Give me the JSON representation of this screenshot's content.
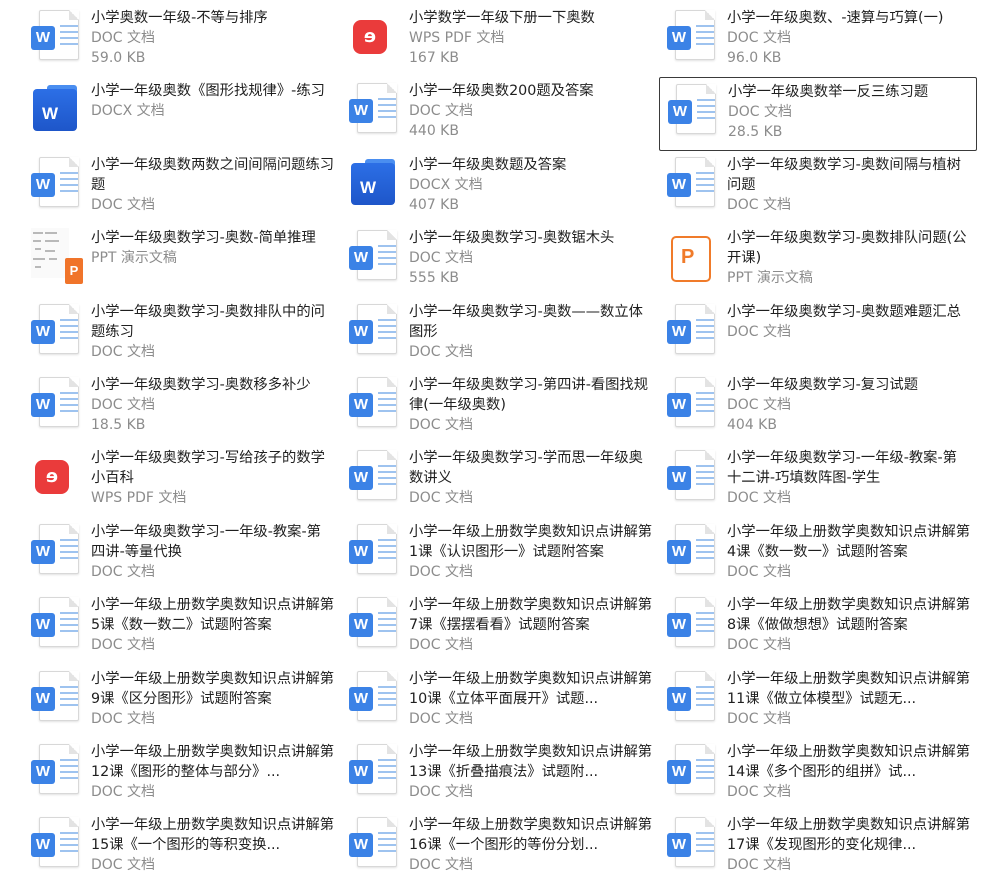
{
  "files": [
    {
      "name": "小学奥数一年级-不等与排序",
      "type": "DOC 文档",
      "size": "59.0 KB",
      "icon": "word-doc-icon"
    },
    {
      "name": "小学数学一年级下册一下奥数",
      "type": "WPS PDF 文档",
      "size": "167 KB",
      "icon": "wps-pdf-icon"
    },
    {
      "name": "小学一年级奥数、-速算与巧算(一)",
      "type": "DOC 文档",
      "size": "96.0 KB",
      "icon": "word-doc-icon"
    },
    {
      "name": "小学一年级奥数《图形找规律》-练习",
      "type": "DOCX 文档",
      "size": "",
      "icon": "word-docx-icon"
    },
    {
      "name": "小学一年级奥数200题及答案",
      "type": "DOC 文档",
      "size": "440 KB",
      "icon": "word-doc-icon"
    },
    {
      "name": "小学一年级奥数举一反三练习题",
      "type": "DOC 文档",
      "size": "28.5 KB",
      "icon": "word-doc-icon",
      "selected": true
    },
    {
      "name": "小学一年级奥数两数之间间隔问题练习题",
      "type": "DOC 文档",
      "size": "",
      "icon": "word-doc-icon"
    },
    {
      "name": "小学一年级奥数题及答案",
      "type": "DOCX 文档",
      "size": "407 KB",
      "icon": "word-docx-icon"
    },
    {
      "name": "小学一年级奥数学习-奥数间隔与植树问题",
      "type": "DOC 文档",
      "size": "",
      "icon": "word-doc-icon"
    },
    {
      "name": "小学一年级奥数学习-奥数-简单推理",
      "type": "PPT 演示文稿",
      "size": "",
      "icon": "ppt-preview-icon"
    },
    {
      "name": "小学一年级奥数学习-奥数锯木头",
      "type": "DOC 文档",
      "size": "555 KB",
      "icon": "word-doc-icon"
    },
    {
      "name": "小学一年级奥数学习-奥数排队问题(公开课)",
      "type": "PPT 演示文稿",
      "size": "",
      "icon": "ppt-file-icon"
    },
    {
      "name": "小学一年级奥数学习-奥数排队中的问题练习",
      "type": "DOC 文档",
      "size": "",
      "icon": "word-doc-icon"
    },
    {
      "name": "小学一年级奥数学习-奥数——数立体图形",
      "type": "DOC 文档",
      "size": "",
      "icon": "word-doc-icon"
    },
    {
      "name": "小学一年级奥数学习-奥数题难题汇总",
      "type": "DOC 文档",
      "size": "",
      "icon": "word-doc-icon"
    },
    {
      "name": "小学一年级奥数学习-奥数移多补少",
      "type": "DOC 文档",
      "size": "18.5 KB",
      "icon": "word-doc-icon"
    },
    {
      "name": "小学一年级奥数学习-第四讲-看图找规律(一年级奥数)",
      "type": "DOC 文档",
      "size": "",
      "icon": "word-doc-icon"
    },
    {
      "name": "小学一年级奥数学习-复习试题",
      "type": "DOC 文档",
      "size": "404 KB",
      "icon": "word-doc-icon"
    },
    {
      "name": "小学一年级奥数学习-写给孩子的数学小百科",
      "type": "WPS PDF 文档",
      "size": "",
      "icon": "wps-pdf-icon"
    },
    {
      "name": "小学一年级奥数学习-学而思一年级奥数讲义",
      "type": "DOC 文档",
      "size": "",
      "icon": "word-doc-icon"
    },
    {
      "name": "小学一年级奥数学习-一年级-教案-第十二讲-巧填数阵图-学生",
      "type": "DOC 文档",
      "size": "",
      "icon": "word-doc-icon"
    },
    {
      "name": "小学一年级奥数学习-一年级-教案-第四讲-等量代换",
      "type": "DOC 文档",
      "size": "",
      "icon": "word-doc-icon"
    },
    {
      "name": "小学一年级上册数学奥数知识点讲解第1课《认识图形一》试题附答案",
      "type": "DOC 文档",
      "size": "",
      "icon": "word-doc-icon"
    },
    {
      "name": "小学一年级上册数学奥数知识点讲解第4课《数一数一》试题附答案",
      "type": "DOC 文档",
      "size": "",
      "icon": "word-doc-icon"
    },
    {
      "name": "小学一年级上册数学奥数知识点讲解第5课《数一数二》试题附答案",
      "type": "DOC 文档",
      "size": "",
      "icon": "word-doc-icon"
    },
    {
      "name": "小学一年级上册数学奥数知识点讲解第7课《摆摆看看》试题附答案",
      "type": "DOC 文档",
      "size": "",
      "icon": "word-doc-icon"
    },
    {
      "name": "小学一年级上册数学奥数知识点讲解第8课《做做想想》试题附答案",
      "type": "DOC 文档",
      "size": "",
      "icon": "word-doc-icon"
    },
    {
      "name": "小学一年级上册数学奥数知识点讲解第9课《区分图形》试题附答案",
      "type": "DOC 文档",
      "size": "",
      "icon": "word-doc-icon"
    },
    {
      "name": "小学一年级上册数学奥数知识点讲解第10课《立体平面展开》试题...",
      "type": "DOC 文档",
      "size": "",
      "icon": "word-doc-icon"
    },
    {
      "name": "小学一年级上册数学奥数知识点讲解第11课《做立体模型》试题无...",
      "type": "DOC 文档",
      "size": "",
      "icon": "word-doc-icon"
    },
    {
      "name": "小学一年级上册数学奥数知识点讲解第12课《图形的整体与部分》...",
      "type": "DOC 文档",
      "size": "",
      "icon": "word-doc-icon"
    },
    {
      "name": "小学一年级上册数学奥数知识点讲解第13课《折叠描痕法》试题附...",
      "type": "DOC 文档",
      "size": "",
      "icon": "word-doc-icon"
    },
    {
      "name": "小学一年级上册数学奥数知识点讲解第14课《多个图形的组拼》试...",
      "type": "DOC 文档",
      "size": "",
      "icon": "word-doc-icon"
    },
    {
      "name": "小学一年级上册数学奥数知识点讲解第15课《一个图形的等积变换...",
      "type": "DOC 文档",
      "size": "",
      "icon": "word-doc-icon"
    },
    {
      "name": "小学一年级上册数学奥数知识点讲解第16课《一个图形的等份分划...",
      "type": "DOC 文档",
      "size": "",
      "icon": "word-doc-icon"
    },
    {
      "name": "小学一年级上册数学奥数知识点讲解第17课《发现图形的变化规律...",
      "type": "DOC 文档",
      "size": "",
      "icon": "word-doc-icon"
    }
  ]
}
